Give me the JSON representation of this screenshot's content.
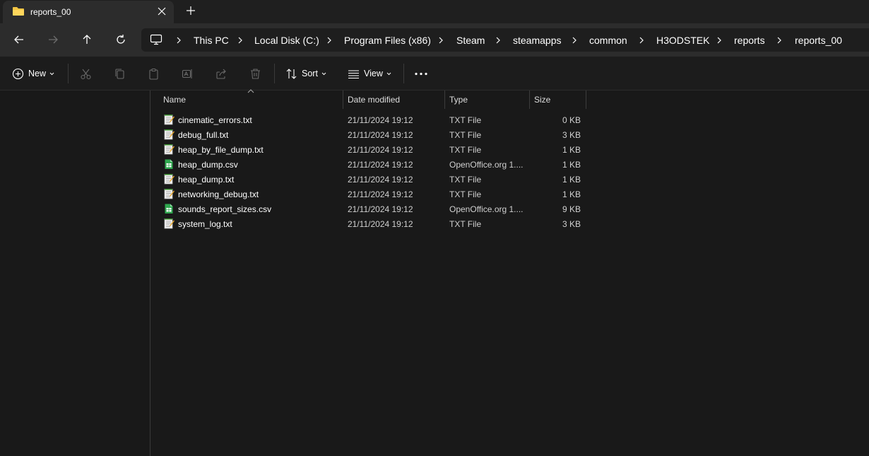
{
  "tab": {
    "title": "reports_00"
  },
  "breadcrumb": [
    "This PC",
    "Local Disk (C:)",
    "Program Files (x86)",
    "Steam",
    "steamapps",
    "common",
    "H3ODSTEK",
    "reports",
    "reports_00"
  ],
  "commands": {
    "new_label": "New",
    "sort_label": "Sort",
    "view_label": "View"
  },
  "columns": {
    "name": "Name",
    "date": "Date modified",
    "type": "Type",
    "size": "Size"
  },
  "files": [
    {
      "name": "cinematic_errors.txt",
      "date": "21/11/2024 19:12",
      "type": "TXT File",
      "size": "0 KB",
      "icon": "text-file-icon"
    },
    {
      "name": "debug_full.txt",
      "date": "21/11/2024 19:12",
      "type": "TXT File",
      "size": "3 KB",
      "icon": "text-file-icon"
    },
    {
      "name": "heap_by_file_dump.txt",
      "date": "21/11/2024 19:12",
      "type": "TXT File",
      "size": "1 KB",
      "icon": "text-file-icon"
    },
    {
      "name": "heap_dump.csv",
      "date": "21/11/2024 19:12",
      "type": "OpenOffice.org 1....",
      "size": "1 KB",
      "icon": "spreadsheet-file-icon"
    },
    {
      "name": "heap_dump.txt",
      "date": "21/11/2024 19:12",
      "type": "TXT File",
      "size": "1 KB",
      "icon": "text-file-icon"
    },
    {
      "name": "networking_debug.txt",
      "date": "21/11/2024 19:12",
      "type": "TXT File",
      "size": "1 KB",
      "icon": "text-file-icon"
    },
    {
      "name": "sounds_report_sizes.csv",
      "date": "21/11/2024 19:12",
      "type": "OpenOffice.org 1....",
      "size": "9 KB",
      "icon": "spreadsheet-file-icon"
    },
    {
      "name": "system_log.txt",
      "date": "21/11/2024 19:12",
      "type": "TXT File",
      "size": "3 KB",
      "icon": "text-file-icon"
    }
  ],
  "colors": {
    "folder": "#f4c543",
    "accent": "#4cc2ff",
    "csv_green": "#2fa84f"
  }
}
